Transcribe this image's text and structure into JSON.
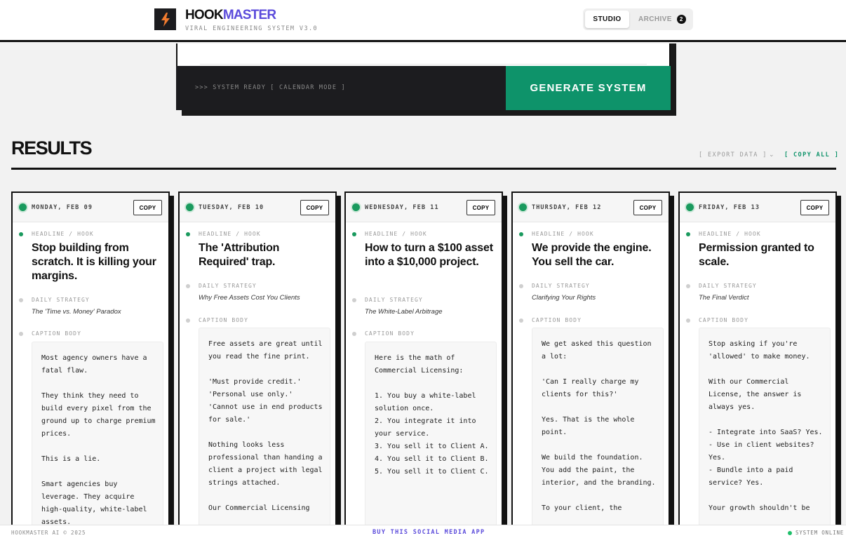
{
  "header": {
    "brand_part1": "HOOK",
    "brand_part2": "MASTER",
    "tagline": "VIRAL ENGINEERING SYSTEM V3.0",
    "logo_icon": "lightning-bolt-icon",
    "tabs": [
      {
        "label": "STUDIO",
        "active": true
      },
      {
        "label": "ARCHIVE",
        "active": false,
        "count": "2"
      }
    ]
  },
  "panel": {
    "status_text": ">>> SYSTEM READY [ CALENDAR MODE ]",
    "generate_label": "GENERATE SYSTEM"
  },
  "results": {
    "title": "RESULTS",
    "export_label": "[ EXPORT DATA ]",
    "copy_all_label": "[ COPY ALL ]"
  },
  "labels": {
    "copy": "COPY",
    "headline": "HEADLINE / HOOK",
    "strategy": "DAILY STRATEGY",
    "caption": "CAPTION BODY"
  },
  "cards": [
    {
      "date": "MONDAY, FEB 09",
      "headline": "Stop building from scratch. It is killing your margins.",
      "strategy": "The 'Time vs. Money' Paradox",
      "caption": "Most agency owners have a fatal flaw.\n\nThey think they need to build every pixel from the ground up to charge premium prices.\n\nThis is a lie.\n\nSmart agencies buy leverage. They acquire high-quality, white-label assets."
    },
    {
      "date": "TUESDAY, FEB 10",
      "headline": "The 'Attribution Required' trap.",
      "strategy": "Why Free Assets Cost You Clients",
      "caption": "Free assets are great until you read the fine print.\n\n'Must provide credit.'\n'Personal use only.'\n'Cannot use in end products for sale.'\n\nNothing looks less professional than handing a client a project with legal strings attached.\n\nOur Commercial Licensing"
    },
    {
      "date": "WEDNESDAY, FEB 11",
      "headline": "How to turn a $100 asset into a $10,000 project.",
      "strategy": "The White-Label Arbitrage",
      "caption": "Here is the math of Commercial Licensing:\n\n1. You buy a white-label solution once.\n2. You integrate it into your service.\n3. You sell it to Client A.\n4. You sell it to Client B.\n5. You sell it to Client C."
    },
    {
      "date": "THURSDAY, FEB 12",
      "headline": "We provide the engine. You sell the car.",
      "strategy": "Clarifying Your Rights",
      "caption": "We get asked this question a lot:\n\n'Can I really charge my clients for this?'\n\nYes. That is the whole point.\n\nWe build the foundation. You add the paint, the interior, and the branding.\n\nTo your client, the"
    },
    {
      "date": "FRIDAY, FEB 13",
      "headline": "Permission granted to scale.",
      "strategy": "The Final Verdict",
      "caption": "Stop asking if you're 'allowed' to make money.\n\nWith our Commercial License, the answer is always yes.\n\n- Integrate into SaaS? Yes.\n- Use in client websites? Yes.\n- Bundle into a paid service? Yes.\n\nYour growth shouldn't be"
    }
  ],
  "footer": {
    "left": "HOOKMASTER AI © 2025",
    "middle": "BUY THIS SOCIAL MEDIA APP",
    "right": "SYSTEM ONLINE"
  },
  "colors": {
    "accent_green": "#0e936a",
    "brand_purple": "#5b4bdb",
    "dark": "#1c1c1f"
  }
}
